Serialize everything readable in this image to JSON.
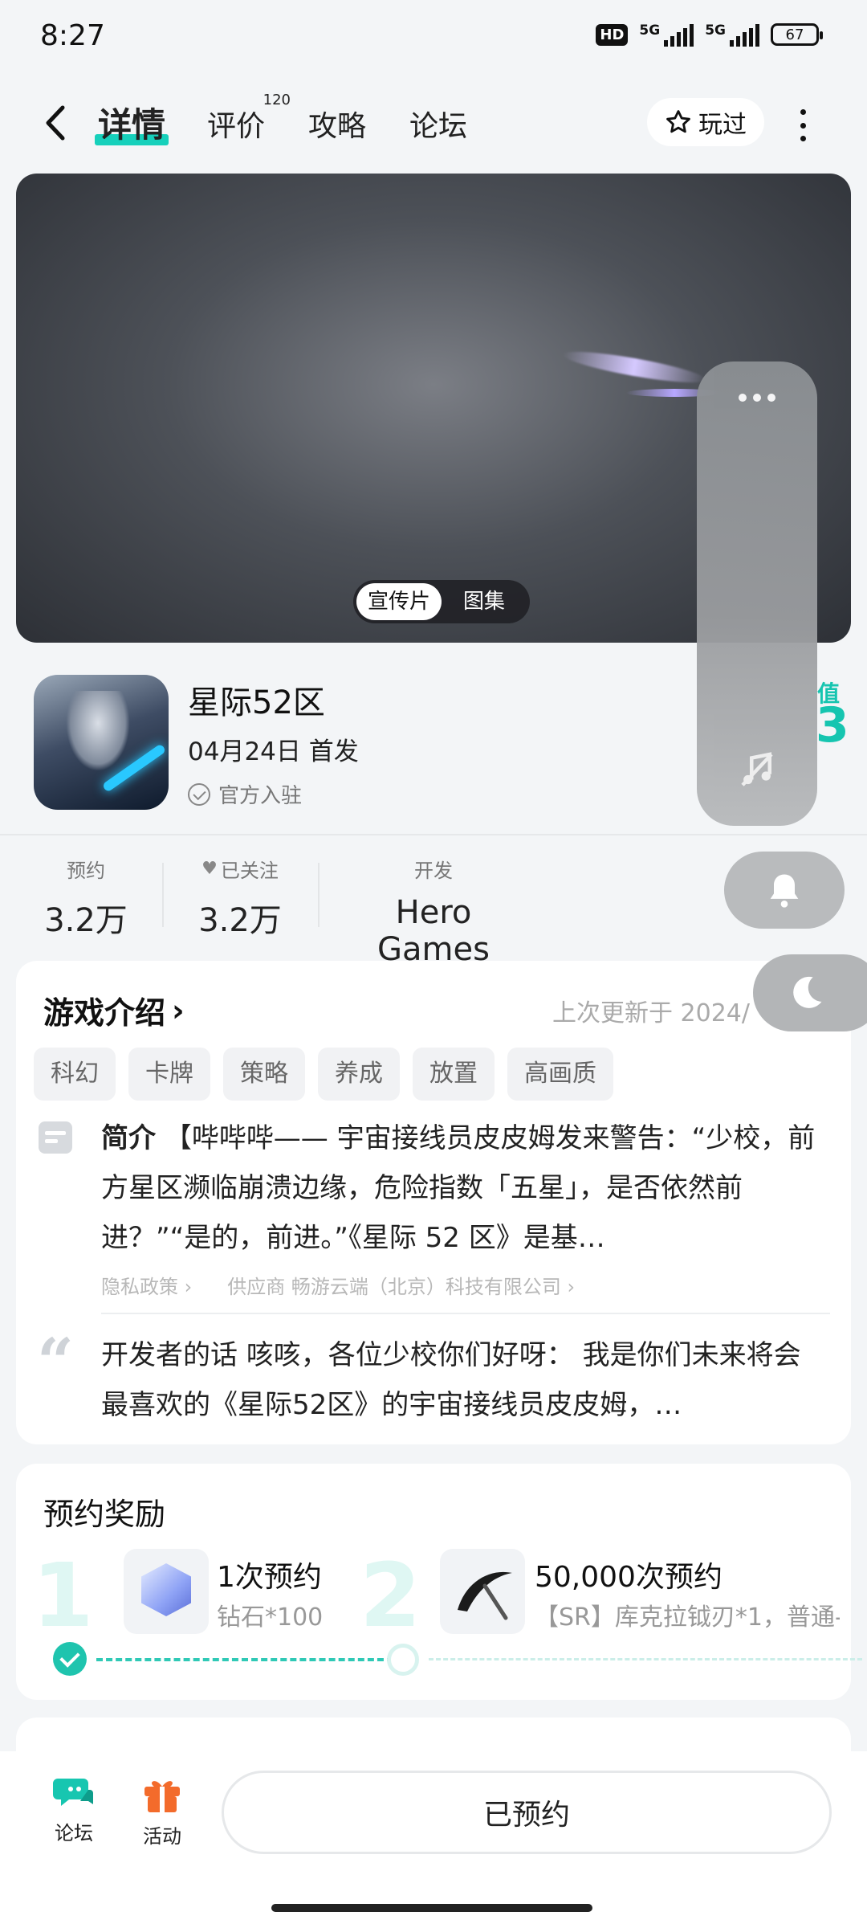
{
  "status": {
    "time": "8:27",
    "hd": "HD",
    "net1": "5G",
    "net2": "5G",
    "battery": "67"
  },
  "header": {
    "tabs": [
      {
        "label": "详情"
      },
      {
        "label": "评价",
        "count": "120"
      },
      {
        "label": "攻略"
      },
      {
        "label": "论坛"
      }
    ],
    "played_label": "玩过"
  },
  "video": {
    "switch": [
      "宣传片",
      "图集"
    ]
  },
  "game": {
    "title": "星际52区",
    "release": "04月24日 首发",
    "official": "官方入驻",
    "value_label": "值",
    "value_num": "3"
  },
  "stats": [
    {
      "label": "预约",
      "value": "3.2万"
    },
    {
      "label": "已关注",
      "value": "3.2万"
    },
    {
      "label": "开发",
      "value": "Hero Games"
    }
  ],
  "intro": {
    "heading": "游戏介绍",
    "updated": "上次更新于 2024/",
    "tags": [
      "科幻",
      "卡牌",
      "策略",
      "养成",
      "放置",
      "高画质"
    ],
    "summary_key": "简介",
    "summary": "【哔哔哔—— 宇宙接线员皮皮姆发来警告：“少校，前方星区濒临崩溃边缘，危险指数「五星」，是否依然前进？”“是的，前进。”《星际 52 区》是基…",
    "privacy": "隐私政策 ›",
    "vendor": "供应商 畅游云端（北京）科技有限公司 ›",
    "dev_key": "开发者的话",
    "dev_text": "咳咳，各位少校你们好呀： 我是你们未来将会最喜欢的《星际52区》的宇宙接线员皮皮姆，…"
  },
  "reward": {
    "heading": "预约奖励",
    "items": [
      {
        "step": "1",
        "title": "1次预约",
        "desc": "钻石*100"
      },
      {
        "step": "2",
        "title": "50,000次预约",
        "desc": "【SR】库克拉钺刃*1，普通-"
      }
    ]
  },
  "bottom": {
    "forum": "论坛",
    "activity": "活动",
    "reserved": "已预约"
  }
}
